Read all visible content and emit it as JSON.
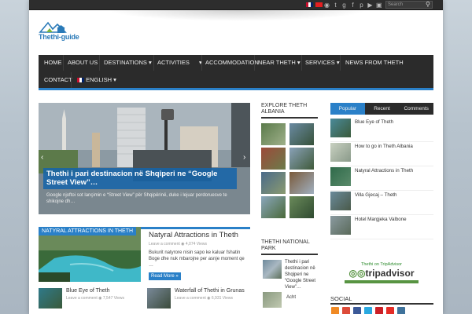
{
  "topbar": {
    "search_placeholder": "Search",
    "social_icons": [
      "rss-icon",
      "twitter-icon",
      "google-plus-icon",
      "facebook-icon",
      "pinterest-icon",
      "youtube-icon",
      "instagram-icon"
    ]
  },
  "logo": {
    "text": "Thethi-guide"
  },
  "nav": {
    "row1": [
      "HOME",
      "ABOUT US",
      "DESTINATIONS",
      "ACTIVITIES",
      "ACCOMMODATION",
      "NEAR THETH",
      "SERVICES",
      "NEWS FROM THETH"
    ],
    "row2": [
      "CONTACT",
      "ENGLISH"
    ]
  },
  "slider": {
    "title": "Thethi i pari destinacion në Shqiperi ne “Google Street View”…",
    "desc": "Google njoftoi sot lançimin e “Street View” për Shqipërinë, duke i lejuar perdoruesve te shikojne dh…"
  },
  "explore": {
    "title": "EXPLORE THETH ALBANIA"
  },
  "tabs": {
    "labels": [
      "Popular",
      "Recent",
      "Comments"
    ],
    "items": [
      "Blue Eye of Theth",
      "How to go in Theth Albania",
      "Natyral Attractions in Theth",
      "Villa Gjecaj – Theth",
      "Hotel Margjeka Valbone"
    ]
  },
  "tripadvisor": {
    "caption": "Thethi on TripAdvisor",
    "logo": "tripadvisor"
  },
  "park": {
    "title": "THETHI NATIONAL PARK",
    "post_text": "Thethi i pari destinacion në Shqiperi ne “Google Street View”…",
    "post2": "Acht"
  },
  "social": {
    "title": "SOCIAL"
  },
  "featured": {
    "label": "NATYRAL ATTRACTIONS IN THETH",
    "title": "Natyral Attractions in Theth",
    "meta": "Leave a comment   ◉ 4,074 Views",
    "text": "Bukurit natyrore nisin sapo ke kaluar fshatin Boge dhe nuk mbarojne per asnje moment qe …",
    "read_more": "Read More »"
  },
  "small_posts": [
    {
      "title": "Blue Eye of Theth",
      "meta": "Leave a comment   ◉ 7,547 Views"
    },
    {
      "title": "Waterfall of Thethi in Grunas",
      "meta": "Leave a comment   ◉ 6,931 Views"
    }
  ],
  "colors": {
    "accent": "#2a80c8",
    "nav_bg": "#2b2b2b",
    "tripadvisor_green": "#589442"
  }
}
